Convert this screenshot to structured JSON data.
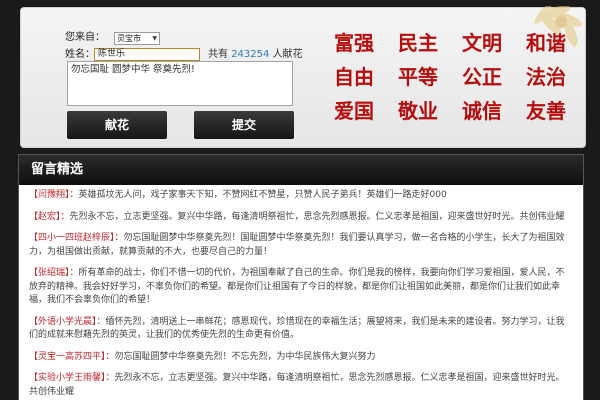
{
  "form": {
    "region_label": "您来自：",
    "region_value": "灵宝市",
    "name_label": "姓名：",
    "name_value": "陈世乐",
    "count_prefix": "共有",
    "count_value": "243254",
    "count_suffix": "人献花",
    "message_value": "勿忘国耻 圆梦中华 祭奠先烈!",
    "flower_button": "献花",
    "submit_button": "提交"
  },
  "core_values": [
    "富强",
    "民主",
    "文明",
    "和谐",
    "自由",
    "平等",
    "公正",
    "法治",
    "爱国",
    "敬业",
    "诚信",
    "友善"
  ],
  "messages": {
    "title": "留言精选",
    "items": [
      {
        "author": "【闫豫翔】：",
        "text": "英雄孤坟无人问，戏子家事天下知，不赞网红不赞星，只赞人民子弟兵！英雄们一路走好000"
      },
      {
        "author": "【赵宏】：",
        "text": "先烈永不忘，立志更坚强。复兴中华路，每逢清明祭祖忙，思念先烈感恩报。仁义忠孝是祖国，迎来盛世好时光。共创伟业耀"
      },
      {
        "author": "【四小一四班赵梓辰】：",
        "text": "勿忘国耻圆梦中华祭奠先烈！国耻圆梦中华祭奠先烈！我们要认真学习，做一名合格的小学生，长大了为祖国效力，为祖国做出贡献，就算贡献的不大，也要尽自己的力量！"
      },
      {
        "author": "【张绍瑞】：",
        "text": "所有革命的战士，你们不惜一切的代价，为祖国奉献了自己的生命。你们是我的榜样，我要向你们学习爱祖国，爱人民，不放弃的精神。我会好好学习，不辜负你们的希望。都是你们让祖国有了今日的样貌，都是你们让祖国如此美丽，都是你们让我们如此幸福，我们不会辜负你们的希望！"
      },
      {
        "author": "【外语小学光晨】：",
        "text": "缅怀先烈，清明送上一串鲜花；感恩现代，珍惜现在的幸福生活；展望将来，我们是未来的建设者。努力学习，让我们的成就来慰藉先烈的英灵，让我们的优秀使先烈的生命更有价值。"
      },
      {
        "author": "【灵宝一高苏四平】：",
        "text": "勿忘国耻圆梦中华祭奠先烈！不忘先烈，为中华民族伟大复兴努力"
      },
      {
        "author": "【实验小学王雨馨】：",
        "text": "先烈永不忘，立志更坚强。复兴中华路，每逢清明祭祖忙，思念先烈感恩报。仁义忠孝是祖国，迎来盛世好时光。共创伟业耀"
      }
    ]
  },
  "colors": {
    "values_red": "#b50d0d",
    "author_red": "#c0262a",
    "count_blue": "#2c7bb6",
    "page_bg": "#1a1a1a"
  }
}
